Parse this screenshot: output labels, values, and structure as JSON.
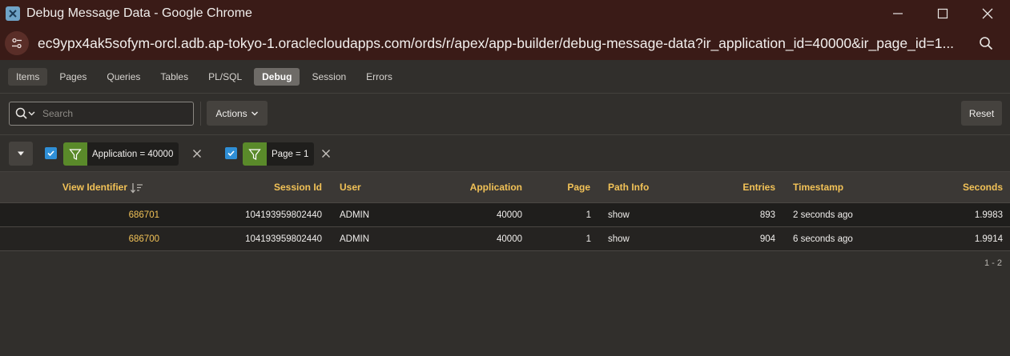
{
  "window": {
    "title": "Debug Message Data - Google Chrome"
  },
  "browser": {
    "url": "ec9ypx4ak5sofym-orcl.adb.ap-tokyo-1.oraclecloudapps.com/ords/r/apex/app-builder/debug-message-data?ir_application_id=40000&ir_page_id=1..."
  },
  "tabs": [
    {
      "label": "Items"
    },
    {
      "label": "Pages"
    },
    {
      "label": "Queries"
    },
    {
      "label": "Tables"
    },
    {
      "label": "PL/SQL"
    },
    {
      "label": "Debug"
    },
    {
      "label": "Session"
    },
    {
      "label": "Errors"
    }
  ],
  "toolbar": {
    "search_placeholder": "Search",
    "actions_label": "Actions",
    "reset_label": "Reset"
  },
  "filters": [
    {
      "label": "Application = 40000",
      "checked": true
    },
    {
      "label": "Page = 1",
      "checked": true
    }
  ],
  "table": {
    "columns": [
      "View Identifier",
      "Session Id",
      "User",
      "Application",
      "Page",
      "Path Info",
      "Entries",
      "Timestamp",
      "Seconds"
    ],
    "rows": [
      [
        "686701",
        "104193959802440",
        "ADMIN",
        "40000",
        "1",
        "show",
        "893",
        "2 seconds ago",
        "1.9983"
      ],
      [
        "686700",
        "104193959802440",
        "ADMIN",
        "40000",
        "1",
        "show",
        "904",
        "6 seconds ago",
        "1.9914"
      ]
    ]
  },
  "pagination": "1 - 2",
  "colors": {
    "titlebar": "#3a1b17",
    "accent_link": "#f2c257",
    "filter_icon_bg": "#5a8a2a",
    "checkbox": "#2f8fd6"
  }
}
